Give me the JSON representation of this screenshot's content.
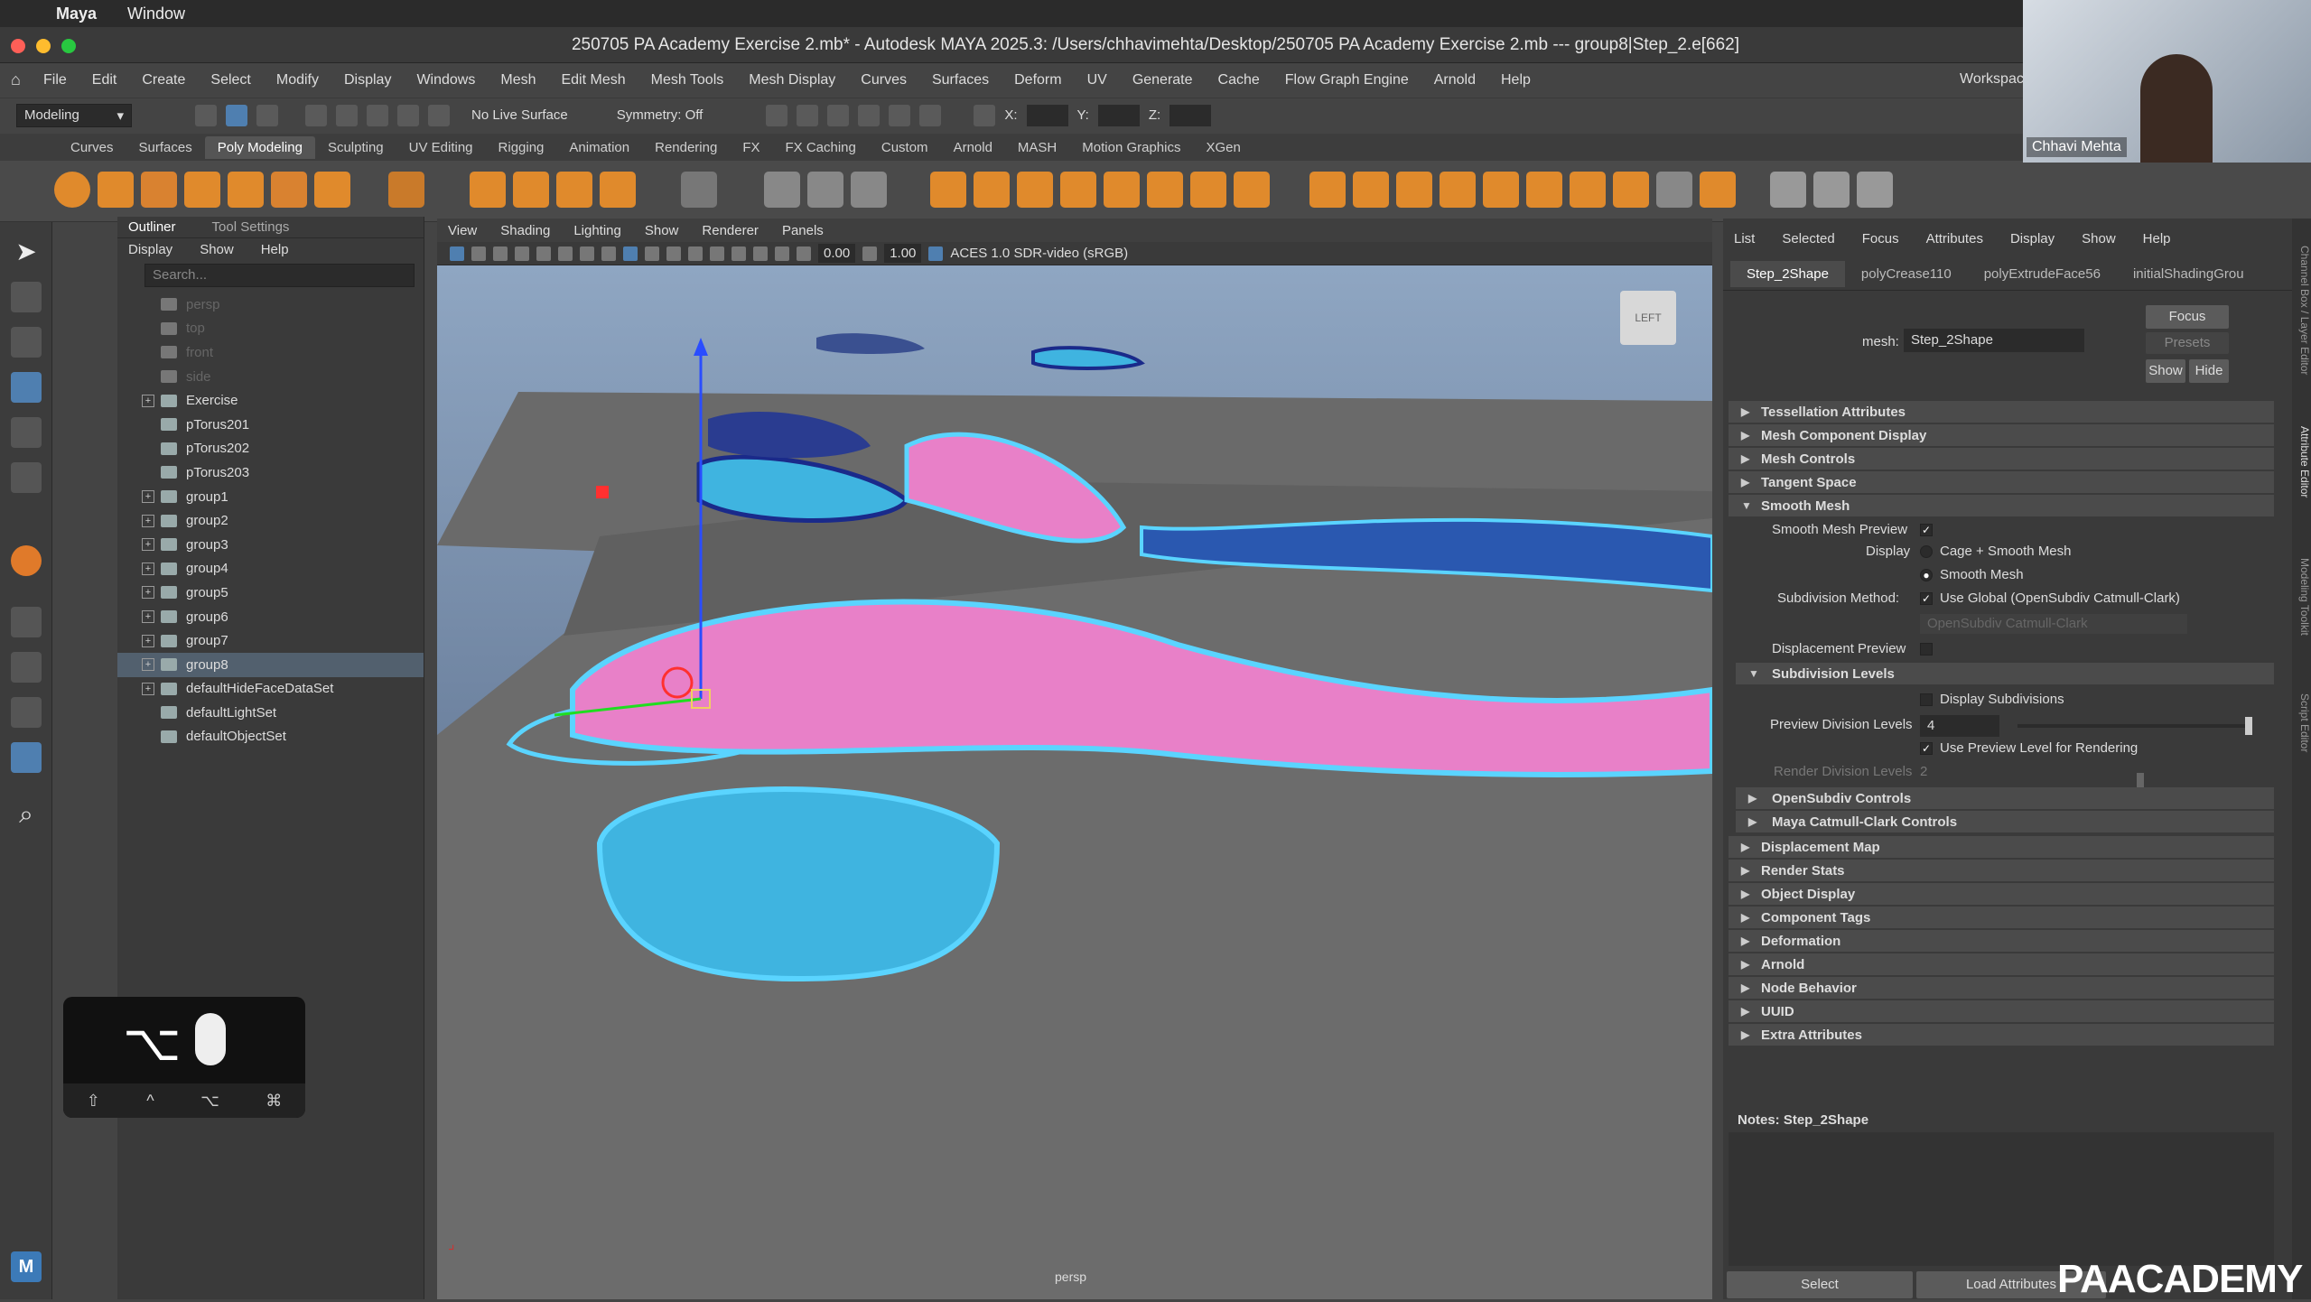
{
  "mac": {
    "app": "Maya",
    "window": "Window"
  },
  "title": "250705 PA Academy Exercise 2.mb* - Autodesk MAYA 2025.3: /Users/chhavimehta/Desktop/250705 PA Academy Exercise 2.mb  ---  group8|Step_2.e[662]",
  "menu": [
    "File",
    "Edit",
    "Create",
    "Select",
    "Modify",
    "Display",
    "Windows",
    "Mesh",
    "Edit Mesh",
    "Mesh Tools",
    "Mesh Display",
    "Curves",
    "Surfaces",
    "Deform",
    "UV",
    "Generate",
    "Cache",
    "Flow Graph Engine",
    "Arnold",
    "Help"
  ],
  "workspace_label": "Workspac",
  "status": {
    "mode": "Modeling",
    "live_surface": "No Live Surface",
    "symmetry": "Symmetry: Off",
    "x": "X:",
    "y": "Y:",
    "z": "Z:"
  },
  "shelf_tabs": [
    "Curves",
    "Surfaces",
    "Poly Modeling",
    "Sculpting",
    "UV Editing",
    "Rigging",
    "Animation",
    "Rendering",
    "FX",
    "FX Caching",
    "Custom",
    "Arnold",
    "MASH",
    "Motion Graphics",
    "XGen"
  ],
  "shelf_active": "Poly Modeling",
  "outliner": {
    "tabs": [
      "Outliner",
      "Tool Settings"
    ],
    "menu": [
      "Display",
      "Show",
      "Help"
    ],
    "search_placeholder": "Search...",
    "items": [
      {
        "label": "persp",
        "type": "cam"
      },
      {
        "label": "top",
        "type": "cam"
      },
      {
        "label": "front",
        "type": "cam"
      },
      {
        "label": "side",
        "type": "cam"
      },
      {
        "label": "Exercise",
        "type": "group",
        "expand": true
      },
      {
        "label": "pTorus201",
        "type": "mesh"
      },
      {
        "label": "pTorus202",
        "type": "mesh"
      },
      {
        "label": "pTorus203",
        "type": "mesh"
      },
      {
        "label": "group1",
        "type": "group",
        "expand": true
      },
      {
        "label": "group2",
        "type": "group",
        "expand": true
      },
      {
        "label": "group3",
        "type": "group",
        "expand": true
      },
      {
        "label": "group4",
        "type": "group",
        "expand": true
      },
      {
        "label": "group5",
        "type": "group",
        "expand": true
      },
      {
        "label": "group6",
        "type": "group",
        "expand": true
      },
      {
        "label": "group7",
        "type": "group",
        "expand": true
      },
      {
        "label": "group8",
        "type": "group",
        "expand": true,
        "selected": true
      },
      {
        "label": "defaultHideFaceDataSet",
        "type": "set",
        "expand": true
      },
      {
        "label": "defaultLightSet",
        "type": "set"
      },
      {
        "label": "defaultObjectSet",
        "type": "set"
      }
    ]
  },
  "keys": {
    "big": "⌥",
    "mods": [
      "⇧",
      "^",
      "⌥",
      "⌘"
    ]
  },
  "viewport": {
    "menu": [
      "View",
      "Shading",
      "Lighting",
      "Show",
      "Renderer",
      "Panels"
    ],
    "val1": "0.00",
    "val2": "1.00",
    "colorspace": "ACES 1.0 SDR-video (sRGB)",
    "cube_label": "LEFT",
    "camera": "persp"
  },
  "attr": {
    "menu": [
      "List",
      "Selected",
      "Focus",
      "Attributes",
      "Display",
      "Show",
      "Help"
    ],
    "tabs": [
      "Step_2Shape",
      "polyCrease110",
      "polyExtrudeFace56",
      "initialShadingGrou"
    ],
    "mesh_label": "mesh:",
    "mesh_value": "Step_2Shape",
    "focus": "Focus",
    "presets": "Presets",
    "show": "Show",
    "hide": "Hide",
    "sections_top": [
      "Tessellation Attributes",
      "Mesh Component Display",
      "Mesh Controls",
      "Tangent Space"
    ],
    "smooth_mesh": "Smooth Mesh",
    "smooth_preview": "Smooth Mesh Preview",
    "display_label": "Display",
    "display_opt1": "Cage + Smooth Mesh",
    "display_opt2": "Smooth Mesh",
    "subdiv_method_label": "Subdivision Method:",
    "subdiv_method_value": "Use Global (OpenSubdiv Catmull-Clark)",
    "subdiv_dropdown": "OpenSubdiv Catmull-Clark",
    "displacement_preview": "Displacement Preview",
    "subdiv_levels": "Subdivision Levels",
    "display_subdivisions": "Display Subdivisions",
    "preview_div_label": "Preview Division Levels",
    "preview_div_value": "4",
    "use_preview": "Use Preview Level for Rendering",
    "render_div_label": "Render Division Levels",
    "render_div_value": "2",
    "sub_sections": [
      "OpenSubdiv Controls",
      "Maya Catmull-Clark Controls"
    ],
    "sections_bottom": [
      "Displacement Map",
      "Render Stats",
      "Object Display",
      "Component Tags",
      "Deformation",
      "Arnold",
      "Node Behavior",
      "UUID",
      "Extra Attributes"
    ],
    "notes": "Notes:  Step_2Shape",
    "select_btn": "Select",
    "load_btn": "Load Attributes"
  },
  "strip_labels": [
    "Channel Box / Layer Editor",
    "Attribute Editor",
    "Modeling Toolkit",
    "Script Editor"
  ],
  "webcam_name": "Chhavi Mehta",
  "watermark": "PAACADEMY",
  "colors": {
    "accent": "#52606e",
    "shelf_orange": "#e08a2c",
    "mesh_cyan": "#49c8ef",
    "mesh_pink": "#e880c8"
  }
}
